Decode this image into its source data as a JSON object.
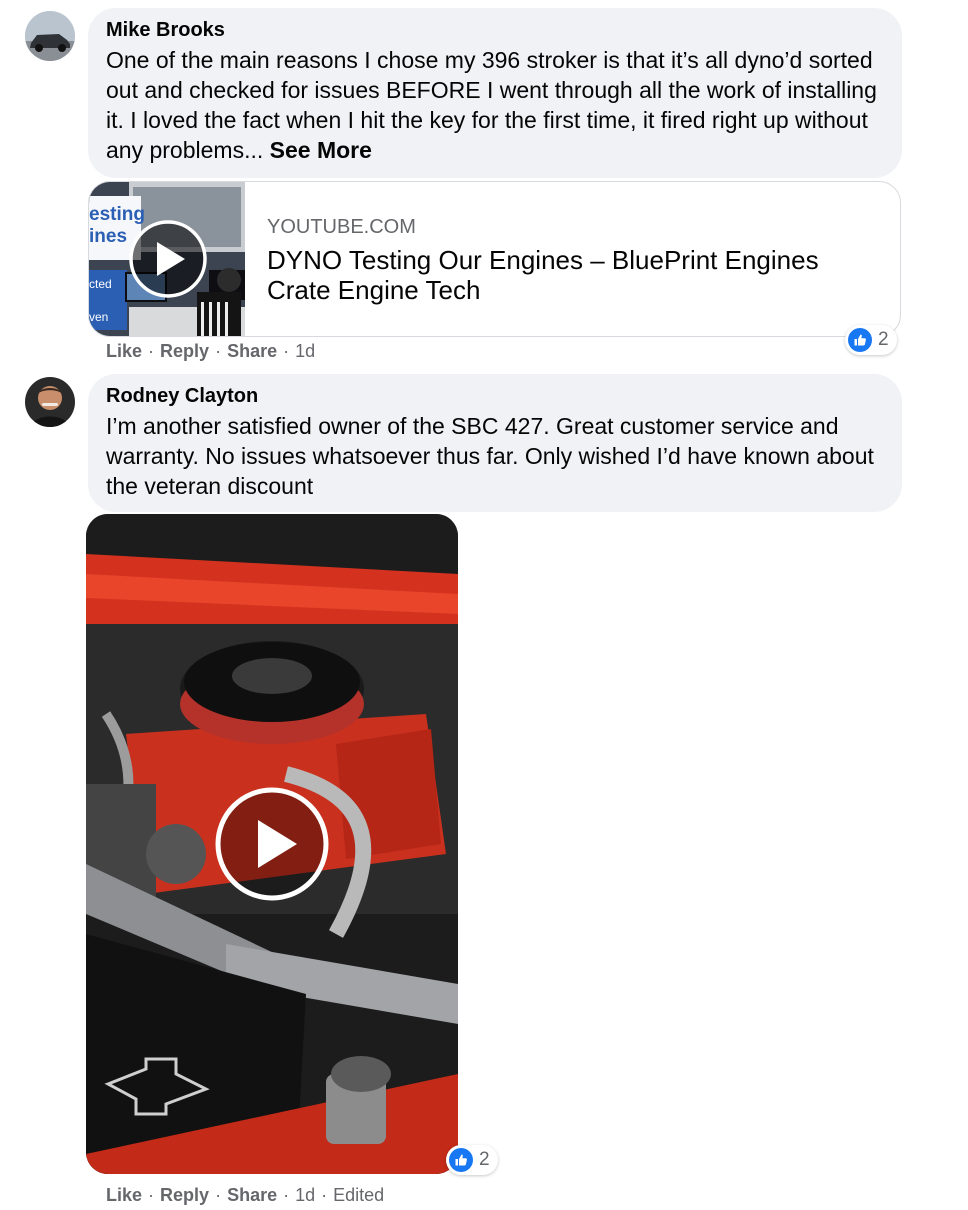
{
  "comments": [
    {
      "author": "Mike Brooks",
      "text": "One of the main reasons I chose my 396 stroker is that it’s all dyno’d sorted out and checked for issues BEFORE I went through all the work of installing it. I loved the fact when I hit the key for the first time, it fired right up without any problems...",
      "see_more": "See More",
      "link": {
        "domain": "YOUTUBE.COM",
        "title": "DYNO Testing Our Engines – BluePrint Engines Crate Engine Tech",
        "thumb_text_1": "esting",
        "thumb_text_2": "ines",
        "thumb_text_3": "cted",
        "thumb_text_4": "ven"
      },
      "actions": {
        "like": "Like",
        "reply": "Reply",
        "share": "Share",
        "sep": "·",
        "time": "1d"
      },
      "reaction_count": "2"
    },
    {
      "author": "Rodney Clayton",
      "text": "I’m another satisfied owner of the SBC 427. Great customer service and warranty. No issues whatsoever thus far. Only wished I’d have known about the veteran discount",
      "actions": {
        "like": "Like",
        "reply": "Reply",
        "share": "Share",
        "sep": "·",
        "time": "1d",
        "edited": "Edited"
      },
      "reaction_count": "2"
    }
  ],
  "colors": {
    "bubble": "#f0f2f5",
    "like_blue": "#1877f2",
    "meta_gray": "#65676b"
  },
  "icons": {
    "like": "thumbs-up-icon",
    "play": "play-icon"
  }
}
